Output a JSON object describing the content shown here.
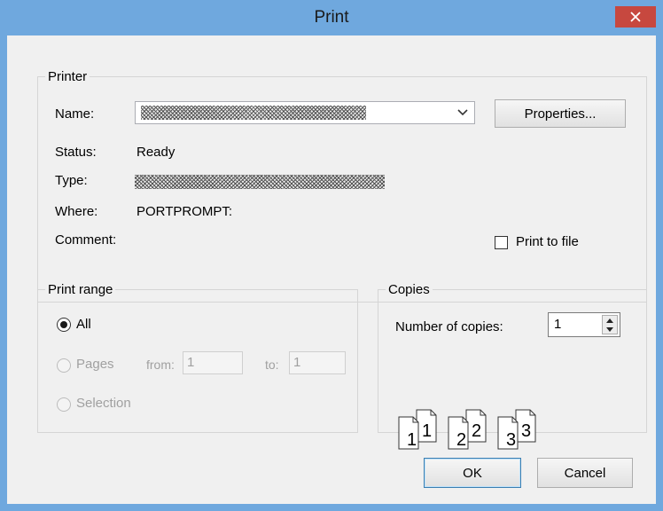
{
  "window": {
    "title": "Print",
    "close_glyph": "✕"
  },
  "printer": {
    "group_label": "Printer",
    "name_label": "Name:",
    "name_value": "",
    "properties_button": "Properties...",
    "status_label": "Status:",
    "status_value": "Ready",
    "type_label": "Type:",
    "type_value": "",
    "where_label": "Where:",
    "where_value": "PORTPROMPT:",
    "comment_label": "Comment:",
    "comment_value": "",
    "print_to_file_label": "Print to file",
    "print_to_file_checked": false
  },
  "print_range": {
    "group_label": "Print range",
    "all_label": "All",
    "pages_label": "Pages",
    "from_label": "from:",
    "from_value": "1",
    "to_label": "to:",
    "to_value": "1",
    "selection_label": "Selection",
    "selected": "All"
  },
  "copies": {
    "group_label": "Copies",
    "number_label": "Number of copies:",
    "number_value": "1",
    "collate_pages": [
      "1",
      "1",
      "2",
      "2",
      "3",
      "3"
    ]
  },
  "buttons": {
    "ok": "OK",
    "cancel": "Cancel"
  },
  "icons": {
    "close": "close-icon",
    "dropdown": "chevron-down-icon",
    "spin_up": "spin-up-icon",
    "spin_down": "spin-down-icon",
    "collate": "collate-pages-icon"
  },
  "colors": {
    "titlebar": "#6fa8de",
    "close_button": "#c7483f",
    "dialog_background": "#f0f0f0"
  }
}
